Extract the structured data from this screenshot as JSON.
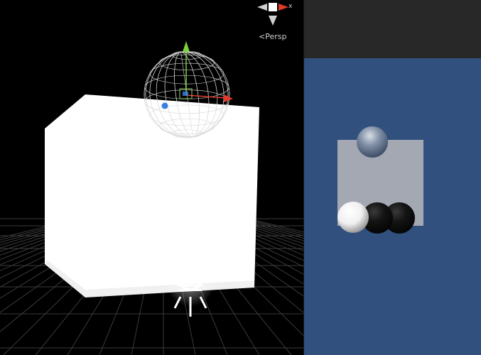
{
  "scene_view": {
    "projection_label": "Persp",
    "projection_glyph": "<",
    "axis_label": "x",
    "colors": {
      "background": "#000000",
      "grid": "#3a3a3a",
      "cube": "#ffffff",
      "wire": "#d8d8d8",
      "handle_x": "#e03a2a",
      "handle_y": "#7fd03a",
      "handle_z": "#3a7fe0"
    },
    "icons": [
      "scene-gizmo-icon",
      "directional-light-icon",
      "move-tool-icon"
    ]
  },
  "game_view": {
    "colors": {
      "toolbar": "#282828",
      "background": "#31507e",
      "quad": "#a3a8b2"
    },
    "objects": [
      "grey-sphere",
      "white-sphere",
      "black-sphere-left",
      "black-sphere-right"
    ]
  }
}
